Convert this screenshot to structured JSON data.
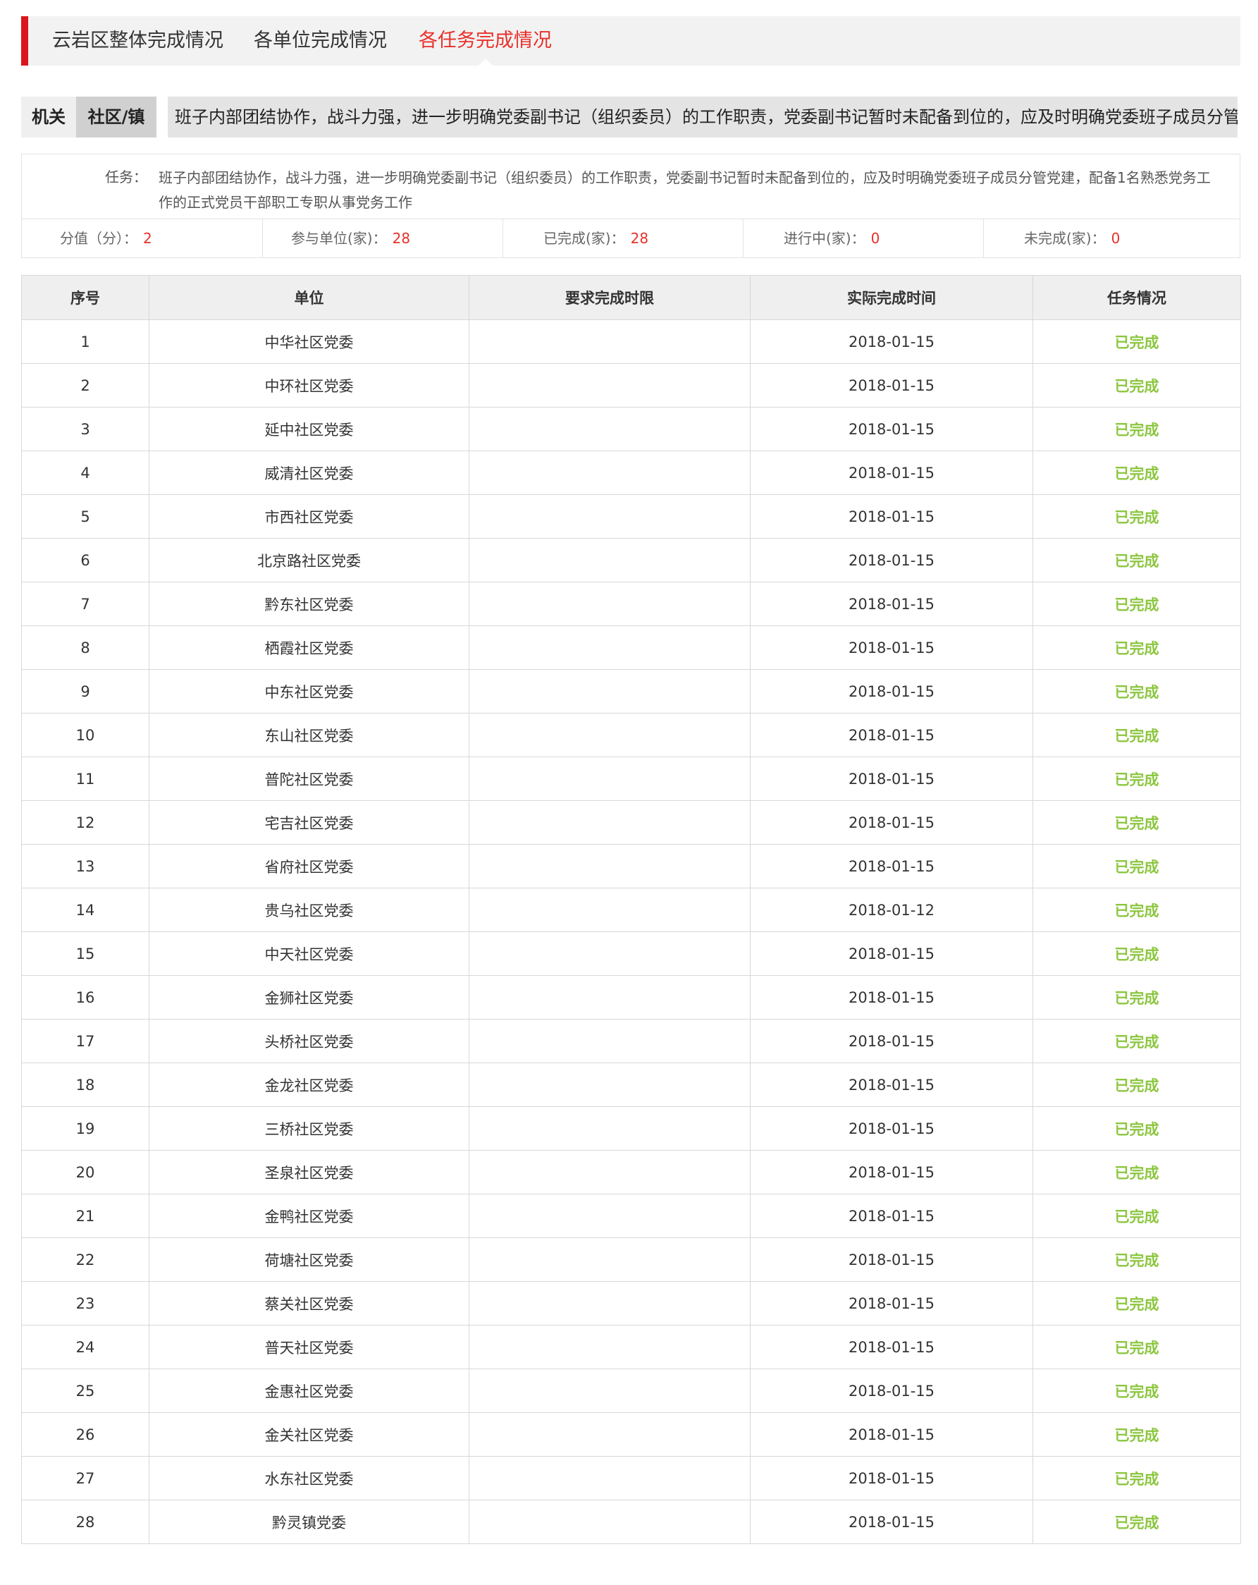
{
  "tabs": [
    {
      "label": "云岩区整体完成情况"
    },
    {
      "label": "各单位完成情况"
    },
    {
      "label": "各任务完成情况"
    }
  ],
  "categories": {
    "agency": "机关",
    "community": "社区/镇",
    "task_short": "班子内部团结协作，战斗力强，进一步明确党委副书记（组织委员）的工作职责，党委副书记暂时未配备到位的，应及时明确党委班子成员分管党建"
  },
  "task": {
    "label": "任务：",
    "text": "班子内部团结协作，战斗力强，进一步明确党委副书记（组织委员）的工作职责，党委副书记暂时未配备到位的，应及时明确党委班子成员分管党建，配备1名熟悉党务工作的正式党员干部职工专职从事党务工作"
  },
  "stats": [
    {
      "label": "分值（分）：",
      "value": "2"
    },
    {
      "label": "参与单位(家)：",
      "value": "28"
    },
    {
      "label": "已完成(家)：",
      "value": "28"
    },
    {
      "label": "进行中(家)：",
      "value": "0"
    },
    {
      "label": "未完成(家)：",
      "value": "0"
    }
  ],
  "table": {
    "headers": [
      "序号",
      "单位",
      "要求完成时限",
      "实际完成时间",
      "任务情况"
    ],
    "rows": [
      [
        "1",
        "中华社区党委",
        "",
        "2018-01-15",
        "已完成"
      ],
      [
        "2",
        "中环社区党委",
        "",
        "2018-01-15",
        "已完成"
      ],
      [
        "3",
        "延中社区党委",
        "",
        "2018-01-15",
        "已完成"
      ],
      [
        "4",
        "威清社区党委",
        "",
        "2018-01-15",
        "已完成"
      ],
      [
        "5",
        "市西社区党委",
        "",
        "2018-01-15",
        "已完成"
      ],
      [
        "6",
        "北京路社区党委",
        "",
        "2018-01-15",
        "已完成"
      ],
      [
        "7",
        "黔东社区党委",
        "",
        "2018-01-15",
        "已完成"
      ],
      [
        "8",
        "栖霞社区党委",
        "",
        "2018-01-15",
        "已完成"
      ],
      [
        "9",
        "中东社区党委",
        "",
        "2018-01-15",
        "已完成"
      ],
      [
        "10",
        "东山社区党委",
        "",
        "2018-01-15",
        "已完成"
      ],
      [
        "11",
        "普陀社区党委",
        "",
        "2018-01-15",
        "已完成"
      ],
      [
        "12",
        "宅吉社区党委",
        "",
        "2018-01-15",
        "已完成"
      ],
      [
        "13",
        "省府社区党委",
        "",
        "2018-01-15",
        "已完成"
      ],
      [
        "14",
        "贵乌社区党委",
        "",
        "2018-01-12",
        "已完成"
      ],
      [
        "15",
        "中天社区党委",
        "",
        "2018-01-15",
        "已完成"
      ],
      [
        "16",
        "金狮社区党委",
        "",
        "2018-01-15",
        "已完成"
      ],
      [
        "17",
        "头桥社区党委",
        "",
        "2018-01-15",
        "已完成"
      ],
      [
        "18",
        "金龙社区党委",
        "",
        "2018-01-15",
        "已完成"
      ],
      [
        "19",
        "三桥社区党委",
        "",
        "2018-01-15",
        "已完成"
      ],
      [
        "20",
        "圣泉社区党委",
        "",
        "2018-01-15",
        "已完成"
      ],
      [
        "21",
        "金鸭社区党委",
        "",
        "2018-01-15",
        "已完成"
      ],
      [
        "22",
        "荷塘社区党委",
        "",
        "2018-01-15",
        "已完成"
      ],
      [
        "23",
        "蔡关社区党委",
        "",
        "2018-01-15",
        "已完成"
      ],
      [
        "24",
        "普天社区党委",
        "",
        "2018-01-15",
        "已完成"
      ],
      [
        "25",
        "金惠社区党委",
        "",
        "2018-01-15",
        "已完成"
      ],
      [
        "26",
        "金关社区党委",
        "",
        "2018-01-15",
        "已完成"
      ],
      [
        "27",
        "水东社区党委",
        "",
        "2018-01-15",
        "已完成"
      ],
      [
        "28",
        "黔灵镇党委",
        "",
        "2018-01-15",
        "已完成"
      ]
    ]
  }
}
